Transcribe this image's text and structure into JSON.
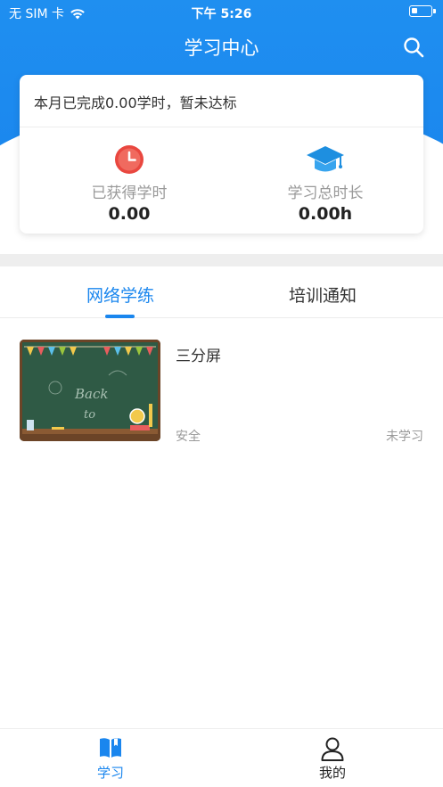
{
  "status_bar": {
    "carrier": "无 SIM 卡",
    "time": "下午 5:26"
  },
  "header": {
    "title": "学习中心",
    "search_icon": "search-icon"
  },
  "stats_card": {
    "message": "本月已完成0.00学时，暂未达标",
    "earned": {
      "icon": "clock-icon",
      "label": "已获得学时",
      "value": "0.00"
    },
    "total": {
      "icon": "graduation-cap-icon",
      "label": "学习总时长",
      "value": "0.00h"
    }
  },
  "tabs": [
    {
      "label": "网络学练",
      "active": true
    },
    {
      "label": "培训通知",
      "active": false
    }
  ],
  "courses": [
    {
      "title": "三分屏",
      "tag": "安全",
      "status": "未学习",
      "thumbnail_text": "Back to school"
    }
  ],
  "bottom_nav": [
    {
      "icon": "book-icon",
      "label": "学习",
      "active": true
    },
    {
      "icon": "user-icon",
      "label": "我的",
      "active": false
    }
  ],
  "colors": {
    "primary": "#1a86ee",
    "clock_red": "#e9473f"
  }
}
